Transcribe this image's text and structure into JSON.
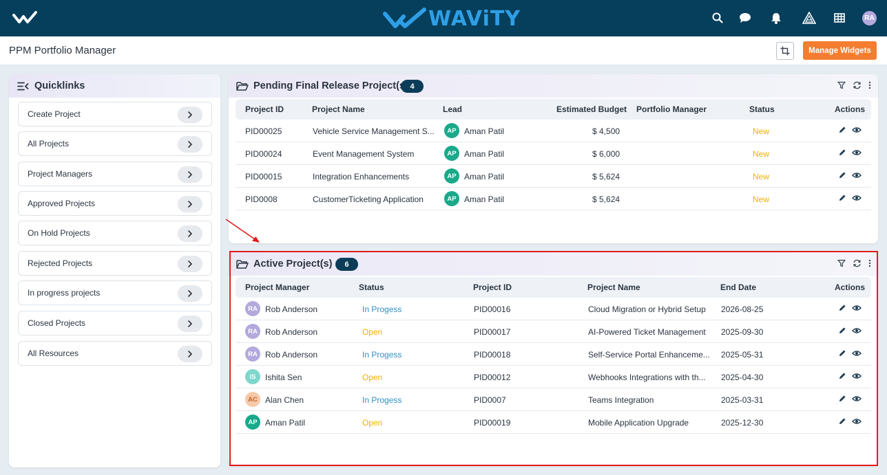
{
  "topbar": {
    "brand_name": "WAViTY",
    "icons": [
      "search-icon",
      "chat-icon",
      "bell-icon",
      "triangle-app-icon",
      "grid-icon"
    ],
    "user_initials": "RA"
  },
  "subheader": {
    "title": "PPM Portfolio Manager",
    "manage_widgets_label": "Manage Widgets"
  },
  "quicklinks": {
    "title": "Quicklinks",
    "items": [
      {
        "label": "Create Project"
      },
      {
        "label": "All Projects"
      },
      {
        "label": "Project Managers"
      },
      {
        "label": "Approved Projects"
      },
      {
        "label": "On Hold Projects"
      },
      {
        "label": "Rejected Projects"
      },
      {
        "label": "In progress projects"
      },
      {
        "label": "Closed Projects"
      },
      {
        "label": "All Resources"
      }
    ]
  },
  "pending": {
    "title": "Pending Final Release Project(s)",
    "count": "4",
    "columns": [
      "Project ID",
      "Project Name",
      "Lead",
      "Estimated Budget",
      "Portfolio Manager",
      "Status",
      "Actions"
    ],
    "rows": [
      {
        "id": "PID00025",
        "name": "Vehicle Service Management S...",
        "lead_initials": "AP",
        "lead": "Aman Patil",
        "budget": "$ 4,500",
        "pm": "",
        "status": "New"
      },
      {
        "id": "PID00024",
        "name": "Event Management System",
        "lead_initials": "AP",
        "lead": "Aman Patil",
        "budget": "$ 6,000",
        "pm": "",
        "status": "New"
      },
      {
        "id": "PID00015",
        "name": "Integration Enhancements",
        "lead_initials": "AP",
        "lead": "Aman Patil",
        "budget": "$ 5,624",
        "pm": "",
        "status": "New"
      },
      {
        "id": "PID0008",
        "name": "CustomerTicketing Application",
        "lead_initials": "AP",
        "lead": "Aman Patil",
        "budget": "$ 5,624",
        "pm": "",
        "status": "New"
      }
    ]
  },
  "active": {
    "title": "Active Project(s)",
    "count": "6",
    "columns": [
      "Project Manager",
      "Status",
      "Project ID",
      "Project Name",
      "End Date",
      "Actions"
    ],
    "rows": [
      {
        "pm_initials": "RA",
        "pm": "Rob Anderson",
        "status": "In Progess",
        "id": "PID00016",
        "name": "Cloud Migration or Hybrid Setup",
        "end": "2026-08-25"
      },
      {
        "pm_initials": "RA",
        "pm": "Rob Anderson",
        "status": "Open",
        "id": "PID00017",
        "name": "AI-Powered Ticket Management",
        "end": "2025-09-30"
      },
      {
        "pm_initials": "RA",
        "pm": "Rob Anderson",
        "status": "In Progess",
        "id": "PID00018",
        "name": "Self-Service Portal Enhanceme...",
        "end": "2025-05-31"
      },
      {
        "pm_initials": "IS",
        "pm": "Ishita Sen",
        "status": "Open",
        "id": "PID00012",
        "name": "Webhooks Integrations with th...",
        "end": "2025-04-30"
      },
      {
        "pm_initials": "AC",
        "pm": "Alan Chen",
        "status": "In Progess",
        "id": "PID0007",
        "name": "Teams Integration",
        "end": "2025-03-31"
      },
      {
        "pm_initials": "AP",
        "pm": "Aman Patil",
        "status": "Open",
        "id": "PID00019",
        "name": "Mobile Application Upgrade",
        "end": "2025-12-30"
      }
    ]
  },
  "colors": {
    "topbar": "#063f5c",
    "brand": "#2e9fe6",
    "accent_orange": "#f47d30",
    "status_new": "#f0b000",
    "status_in_progress": "#2f8fc6",
    "avatar_ra": "#b3a9dc",
    "avatar_ap": "#1aa98a",
    "avatar_is": "#7fd6cc",
    "avatar_ac": "#f6c9a8",
    "highlight": "#e21b1b"
  }
}
